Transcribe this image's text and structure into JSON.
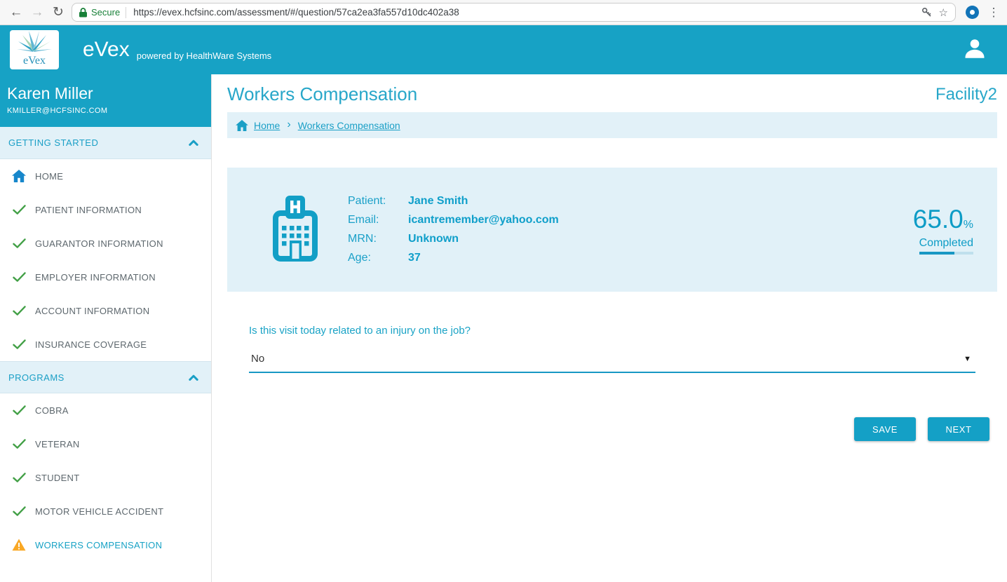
{
  "icons": {
    "back": "←",
    "forward": "→",
    "refresh": "↻",
    "overflow_menu": "⋮",
    "bookmark_star": "☆",
    "breadcrumb_separator": "›",
    "dropdown_caret": "▼"
  },
  "colors": {
    "accent_teal": "#17a2c5",
    "panel_light_blue": "#e2f1f8",
    "check_green": "#43a047",
    "warning_amber": "#f9a825",
    "secure_green": "#188038"
  },
  "browser": {
    "security_label": "Secure",
    "url": "https://evex.hcfsinc.com/assessment/#/question/57ca2ea3fa557d10dc402a38"
  },
  "header": {
    "logo_text": "eVex",
    "app_name": "eVex",
    "tagline": "powered by HealthWare Systems"
  },
  "sidebar": {
    "user": {
      "name": "Karen Miller",
      "email": "KMILLER@HCFSINC.COM"
    },
    "sections": [
      {
        "label": "GETTING STARTED",
        "items": [
          {
            "label": "HOME",
            "icon": "home-icon"
          },
          {
            "label": "PATIENT INFORMATION",
            "icon": "check-icon"
          },
          {
            "label": "GUARANTOR INFORMATION",
            "icon": "check-icon"
          },
          {
            "label": "EMPLOYER INFORMATION",
            "icon": "check-icon"
          },
          {
            "label": "ACCOUNT INFORMATION",
            "icon": "check-icon"
          },
          {
            "label": "INSURANCE COVERAGE",
            "icon": "check-icon"
          }
        ]
      },
      {
        "label": "PROGRAMS",
        "items": [
          {
            "label": "COBRA",
            "icon": "check-icon"
          },
          {
            "label": "VETERAN",
            "icon": "check-icon"
          },
          {
            "label": "STUDENT",
            "icon": "check-icon"
          },
          {
            "label": "MOTOR VEHICLE ACCIDENT",
            "icon": "check-icon"
          },
          {
            "label": "WORKERS COMPENSATION",
            "icon": "warning-icon",
            "active": true
          }
        ]
      }
    ]
  },
  "main": {
    "title": "Workers Compensation",
    "facility": "Facility2",
    "breadcrumb": {
      "items": [
        {
          "label": "Home"
        },
        {
          "label": "Workers Compensation"
        }
      ]
    },
    "patient_card": {
      "fields": [
        {
          "label": "Patient:",
          "value": "Jane Smith"
        },
        {
          "label": "Email:",
          "value": "icantremember@yahoo.com"
        },
        {
          "label": "MRN:",
          "value": "Unknown"
        },
        {
          "label": "Age:",
          "value": "37"
        }
      ],
      "progress": {
        "percent": "65.0",
        "unit": "%",
        "label": "Completed",
        "value": 65
      }
    },
    "question": "Is this visit today related to an injury on the job?",
    "answer": "No",
    "buttons": {
      "save": "SAVE",
      "next": "NEXT"
    }
  }
}
